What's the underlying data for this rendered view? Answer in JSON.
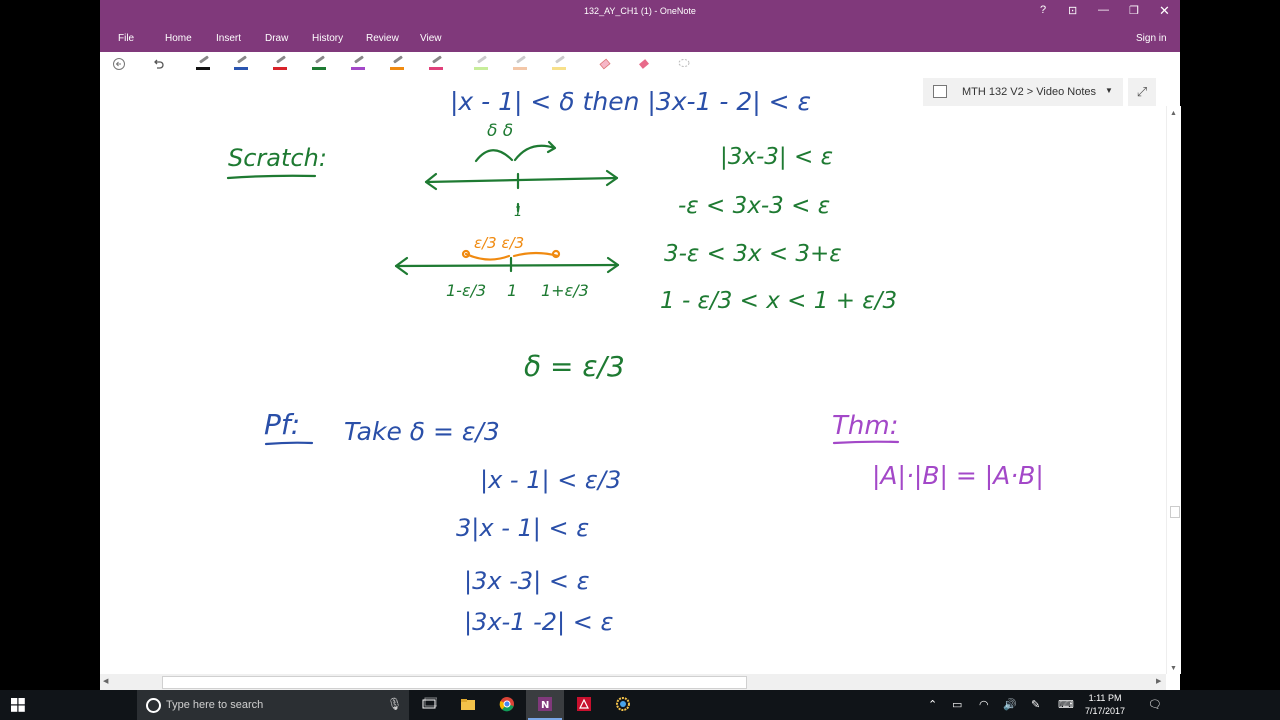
{
  "window": {
    "title": "132_AY_CH1 (1) - OneNote",
    "controls": [
      "?",
      "restore-ribbon",
      "minimize",
      "maximize",
      "close"
    ]
  },
  "menu": {
    "items": [
      "File",
      "Home",
      "Insert",
      "Draw",
      "History",
      "Review",
      "View"
    ],
    "sign_in": "Sign in"
  },
  "toolbar": {
    "pens": [
      "#111111",
      "#2a55b0",
      "#d8232a",
      "#1e7a32",
      "#a348c8",
      "#f08a10",
      "#e0407a",
      "#c7ed9a",
      "#f3c7a8",
      "#f7e08a"
    ],
    "icons": [
      "back-icon",
      "undo-icon",
      "eraser-icon",
      "eraser-pink-icon",
      "lasso-icon"
    ]
  },
  "notebook": {
    "breadcrumb": "MTH 132 V2 > Video Notes"
  },
  "ink": {
    "header": "|x - 1| < δ   then   |3x-1 - 2| < ε",
    "scratch_label": "Scratch:",
    "delta_arcs": "δ  δ",
    "tick_one": "1",
    "eps_arcs": "ε/3  ε/3",
    "number_line_labels": [
      "1-ε/3",
      "1",
      "1+ε/3"
    ],
    "scratch_steps": [
      "|3x-3| < ε",
      "-ε < 3x-3 < ε",
      "3-ε < 3x < 3+ε",
      "1 - ε/3 < x < 1 + ε/3"
    ],
    "delta_result": "δ = ε/3",
    "proof_label": "Pf:",
    "proof_take": "Take δ = ε/3",
    "proof_steps": [
      "|x - 1| < ε/3",
      "3|x - 1| < ε",
      "|3x -3| < ε",
      "|3x-1 -2| < ε"
    ],
    "theorem_label": "Thm:",
    "theorem_statement": "|A|·|B| = |A·B|"
  },
  "colors": {
    "ink_blue": "#2a4fa8",
    "ink_green": "#1e7a32",
    "ink_orange": "#f08a10",
    "ink_purple": "#a348c8",
    "titlebar": "#80397b"
  },
  "taskbar": {
    "search_placeholder": "Type here to search",
    "apps": [
      "task-view-icon",
      "file-explorer-icon",
      "chrome-icon",
      "onenote-icon",
      "acrobat-icon",
      "settings-app-icon"
    ],
    "time": "1:11 PM",
    "date": "7/17/2017"
  }
}
